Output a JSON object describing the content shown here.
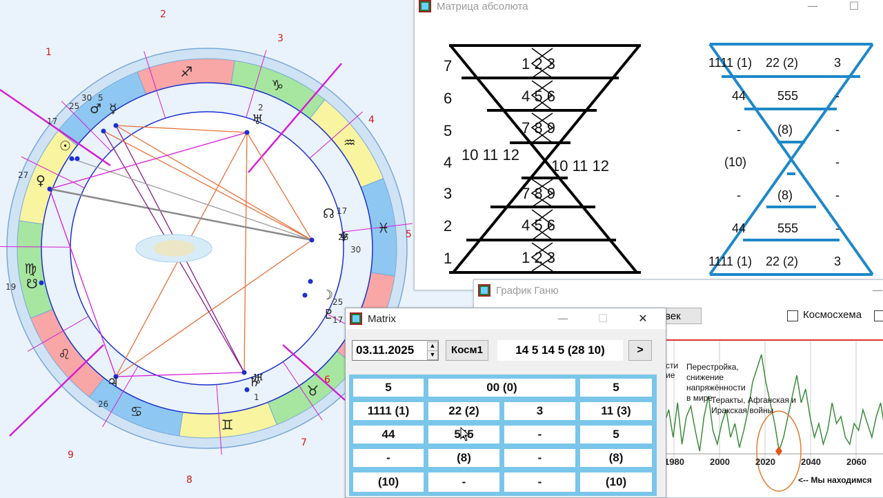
{
  "astro": {
    "house_numbers": [
      "1",
      "2",
      "3",
      "4",
      "5",
      "6",
      "7",
      "8",
      "9"
    ],
    "planet_labels": [
      "17",
      "25",
      "30",
      "5",
      "27",
      "2",
      "17",
      "26",
      "30",
      "19",
      "25",
      "17",
      "26",
      "1"
    ],
    "sign_glyphs": [
      "♐",
      "♑",
      "♒",
      "♓",
      "♈",
      "♉",
      "♊",
      "♋",
      "♌",
      "♍"
    ],
    "planet_glyphs": [
      "☉",
      "♀",
      "♂",
      "♃",
      "♄",
      "♅",
      "♆",
      "☊",
      "☋",
      "☽",
      "♇",
      "☿",
      "♅"
    ],
    "retro_mark": "R"
  },
  "abs_window": {
    "title": "Матрица абсолюта",
    "minimize": "—",
    "maximize": "☐",
    "left_levels": [
      "7",
      "6",
      "5",
      "4",
      "3",
      "2",
      "1"
    ],
    "left_rows": [
      "1 2 3",
      "4 5 6",
      "7 8 9",
      "10 11 12",
      "10 11 12",
      "7 8 9",
      "4 5 6",
      "1 2 3"
    ],
    "right_rows": [
      {
        "a": "1111 (1)",
        "b": "22 (2)",
        "c": "3"
      },
      {
        "a": "44",
        "b": "555",
        "c": "-"
      },
      {
        "a": "-",
        "b": "(8)",
        "c": "-"
      },
      {
        "a": "(10)",
        "b": "",
        "c": "-"
      },
      {
        "a": "-",
        "b": "(8)",
        "c": "-"
      },
      {
        "a": "44",
        "b": "555",
        "c": "-"
      },
      {
        "a": "1111 (1)",
        "b": "22 (2)",
        "c": "3"
      }
    ]
  },
  "gann_window": {
    "title": "График Ганю",
    "button_partial": "век",
    "checkbox_kosmo": "Космосхема",
    "annotations": {
      "left_partial_1": "сти",
      "left_partial_2": "ие",
      "perestroika": "Перестройка,",
      "snizhenie": "снижение",
      "napryazh": "напряжённости",
      "v_mire": "в мире",
      "terakty": "Теракты, Афганская и",
      "irak": "Иракская войны",
      "here": "<-- Мы находимся"
    },
    "x_ticks": [
      "1980",
      "2000",
      "2020",
      "2040",
      "2060"
    ]
  },
  "matrix_window": {
    "title": "Matrix",
    "minimize": "—",
    "maximize": "☐",
    "close": "✕",
    "date_value": "03.11.2025",
    "kosm_button": "Косм1",
    "code_value": "14 5 14 5 (28 10)",
    "next_button": ">",
    "rows": [
      [
        "5",
        "00 (0)",
        "5"
      ],
      [
        "1111 (1)",
        "22 (2)",
        "3",
        "11 (3)"
      ],
      [
        "44",
        "555",
        "-",
        "5"
      ],
      [
        "-",
        "(8)",
        "-",
        "(8)"
      ],
      [
        "(10)",
        "-",
        "-",
        "(10)"
      ]
    ]
  },
  "colors": {
    "magenta": "#d81bd8",
    "orange_line": "#e8703a",
    "blue_tri": "#1e88c8",
    "blue_point": "#1b2fd0",
    "ring_outer": "#cfe3f5"
  }
}
